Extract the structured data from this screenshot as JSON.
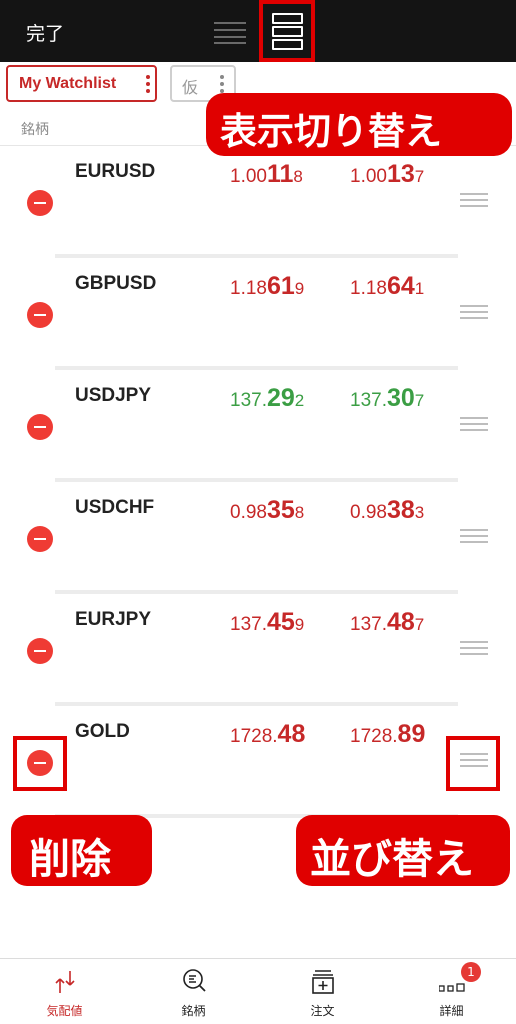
{
  "topbar": {
    "done_label": "完了",
    "view_toggle_compact_icon": "list-compact-icon",
    "view_toggle_expanded_icon": "list-expanded-icon"
  },
  "watchlist": {
    "name": "My Watchlist",
    "secondary_name": "仮",
    "column_header": "銘柄"
  },
  "rows": [
    {
      "symbol": "EURUSD",
      "bid": [
        "1.00",
        "11",
        "8"
      ],
      "ask": [
        "1.00",
        "13",
        "7"
      ],
      "color": "#c62828"
    },
    {
      "symbol": "GBPUSD",
      "bid": [
        "1.18",
        "61",
        "9"
      ],
      "ask": [
        "1.18",
        "64",
        "1"
      ],
      "color": "#c62828"
    },
    {
      "symbol": "USDJPY",
      "bid": [
        "137.",
        "29",
        "2"
      ],
      "ask": [
        "137.",
        "30",
        "7"
      ],
      "color": "#3b9e44"
    },
    {
      "symbol": "USDCHF",
      "bid": [
        "0.98",
        "35",
        "8"
      ],
      "ask": [
        "0.98",
        "38",
        "3"
      ],
      "color": "#c62828"
    },
    {
      "symbol": "EURJPY",
      "bid": [
        "137.",
        "45",
        "9"
      ],
      "ask": [
        "137.",
        "48",
        "7"
      ],
      "color": "#c62828"
    },
    {
      "symbol": "GOLD",
      "bid": [
        "1728.",
        "48",
        ""
      ],
      "ask": [
        "1728.",
        "89",
        ""
      ],
      "color": "#c62828"
    }
  ],
  "callouts": {
    "view_toggle": "表示切り替え",
    "delete": "削除",
    "reorder": "並び替え"
  },
  "nav": {
    "items": [
      {
        "label": "気配値",
        "icon": "quotes-icon"
      },
      {
        "label": "銘柄",
        "icon": "symbol-search-icon"
      },
      {
        "label": "注文",
        "icon": "order-icon"
      },
      {
        "label": "詳細",
        "icon": "more-icon"
      }
    ],
    "badge_count": "1"
  },
  "colors": {
    "accent": "#c62828",
    "up": "#3b9e44",
    "highlight": "#e00000",
    "topbar_bg": "#141414"
  }
}
